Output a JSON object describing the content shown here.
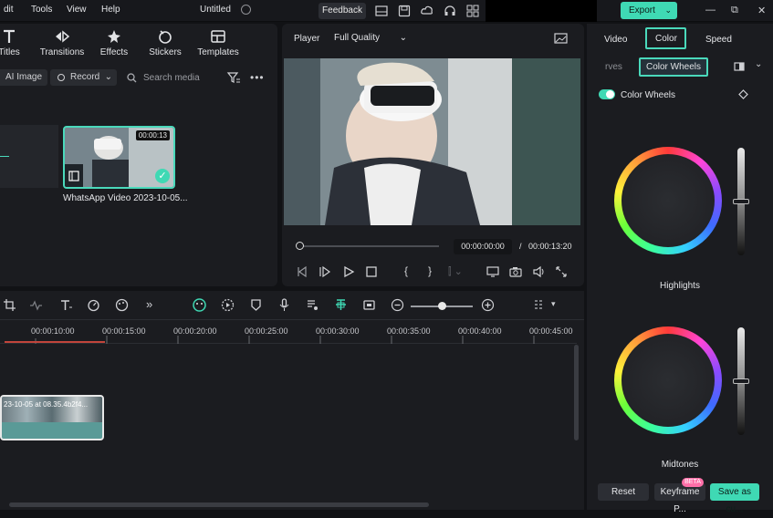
{
  "menubar": {
    "items": [
      "dit",
      "Tools",
      "View",
      "Help"
    ],
    "doc_title": "Untitled",
    "feedback_label": "Feedback",
    "export_label": "Export"
  },
  "media": {
    "tools": [
      {
        "label": "Titles",
        "icon": "titles-icon"
      },
      {
        "label": "Transitions",
        "icon": "transitions-icon"
      },
      {
        "label": "Effects",
        "icon": "effects-icon"
      },
      {
        "label": "Stickers",
        "icon": "stickers-icon"
      },
      {
        "label": "Templates",
        "icon": "templates-icon"
      }
    ],
    "ai_image_label": "AI Image",
    "record_label": "Record",
    "search_placeholder": "Search media",
    "clip": {
      "duration": "00:00:13",
      "name": "WhatsApp Video 2023-10-05..."
    }
  },
  "player": {
    "label": "Player",
    "quality": "Full Quality",
    "current_time": "00:00:00:00",
    "separator": "/",
    "total_time": "00:00:13:20"
  },
  "color_panel": {
    "tabs": [
      "Video",
      "Color",
      "Speed"
    ],
    "active_tab": "Color",
    "subtabs": [
      "rves",
      "Color Wheels"
    ],
    "active_subtab": "Color Wheels",
    "color_wheels_toggle_label": "Color Wheels",
    "wheels": [
      {
        "label": "Highlights",
        "level": 0.5
      },
      {
        "label": "Midtones",
        "level": 0.5
      }
    ],
    "reset_label": "Reset",
    "keyframe_label": "Keyframe P...",
    "beta_badge": "BETA",
    "save_label": "Save as cu..."
  },
  "timeline": {
    "ticks": [
      "00:00:10:00",
      "00:00:15:00",
      "00:00:20:00",
      "00:00:25:00",
      "00:00:30:00",
      "00:00:35:00",
      "00:00:40:00",
      "00:00:45:00"
    ],
    "track_clip_label": "23-10-05 at 08.35.4b2f4..."
  },
  "colors": {
    "accent": "#3fd9b4",
    "playhead": "#c2443b",
    "panel_bg": "#1b1c20",
    "app_bg": "#111215"
  }
}
